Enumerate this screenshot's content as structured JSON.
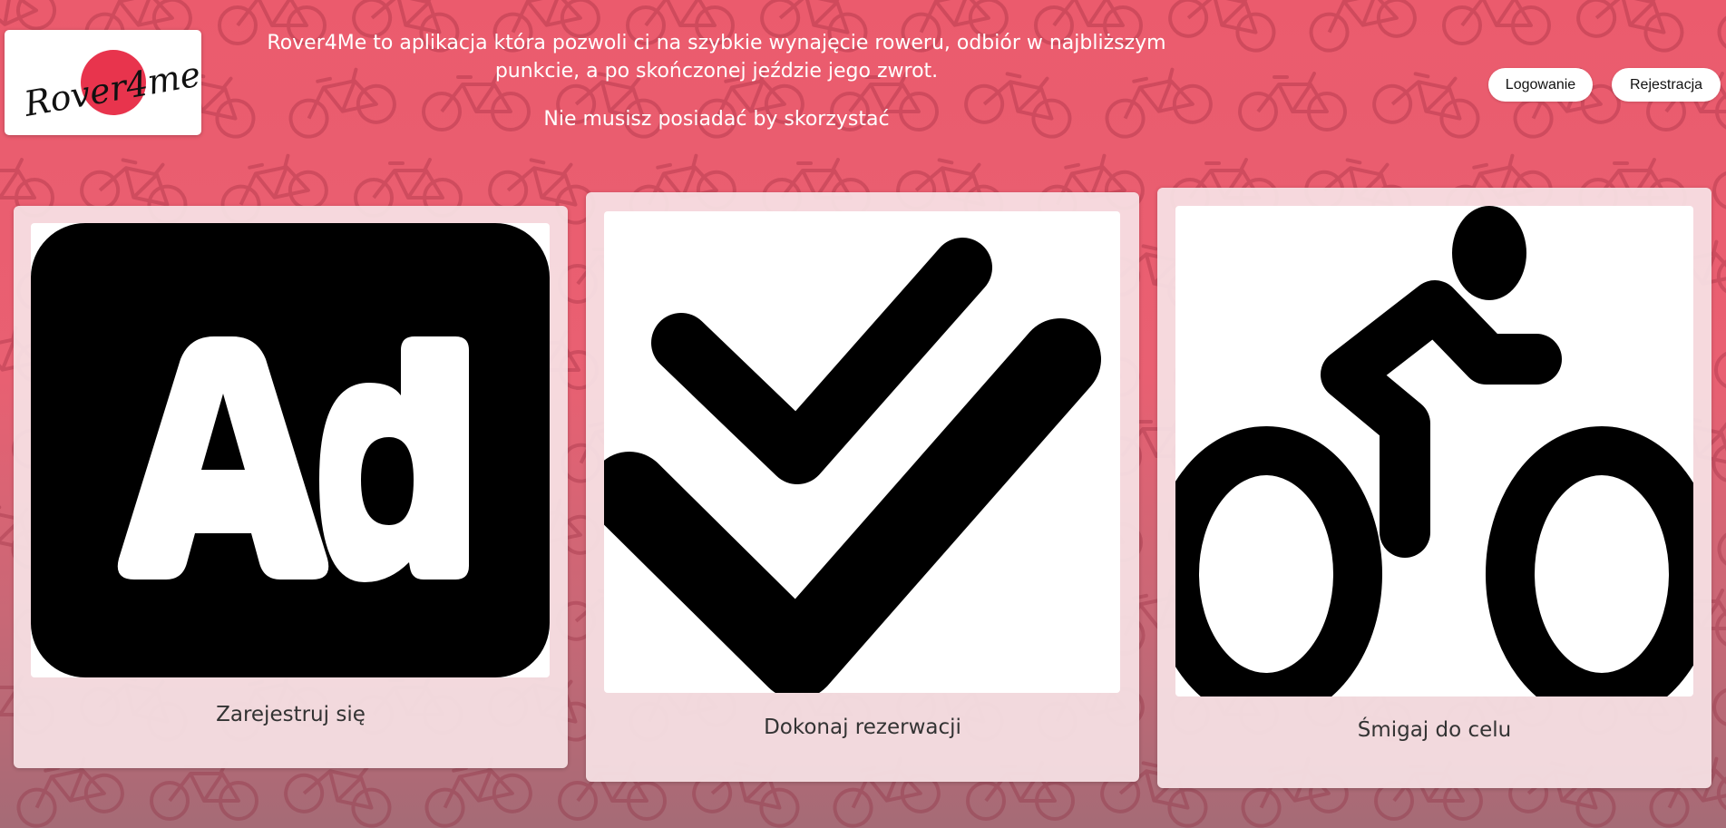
{
  "logo": {
    "text": "Rover4me",
    "accent_color": "#e8344d"
  },
  "intro": {
    "description": "Rover4Me to aplikacja która pozwoli ci na szybkie wynajęcie roweru, odbiór w najbliższym punkcie, a po skończonej jeździe jego zwrot.",
    "tagline": "Nie musisz posiadać by skorzystać"
  },
  "nav": {
    "login_label": "Logowanie",
    "register_label": "Rejestracja"
  },
  "cards": [
    {
      "icon": "ad-icon",
      "caption": "Zarejestruj się"
    },
    {
      "icon": "double-check-icon",
      "caption": "Dokonaj rezerwacji"
    },
    {
      "icon": "bicycle-rider-icon",
      "caption": "Śmigaj do celu"
    }
  ],
  "colors": {
    "background_top": "#eb5b6d",
    "background_bottom": "#a56b76",
    "card_background": "#f6e2e5",
    "icon_color": "#000000"
  }
}
